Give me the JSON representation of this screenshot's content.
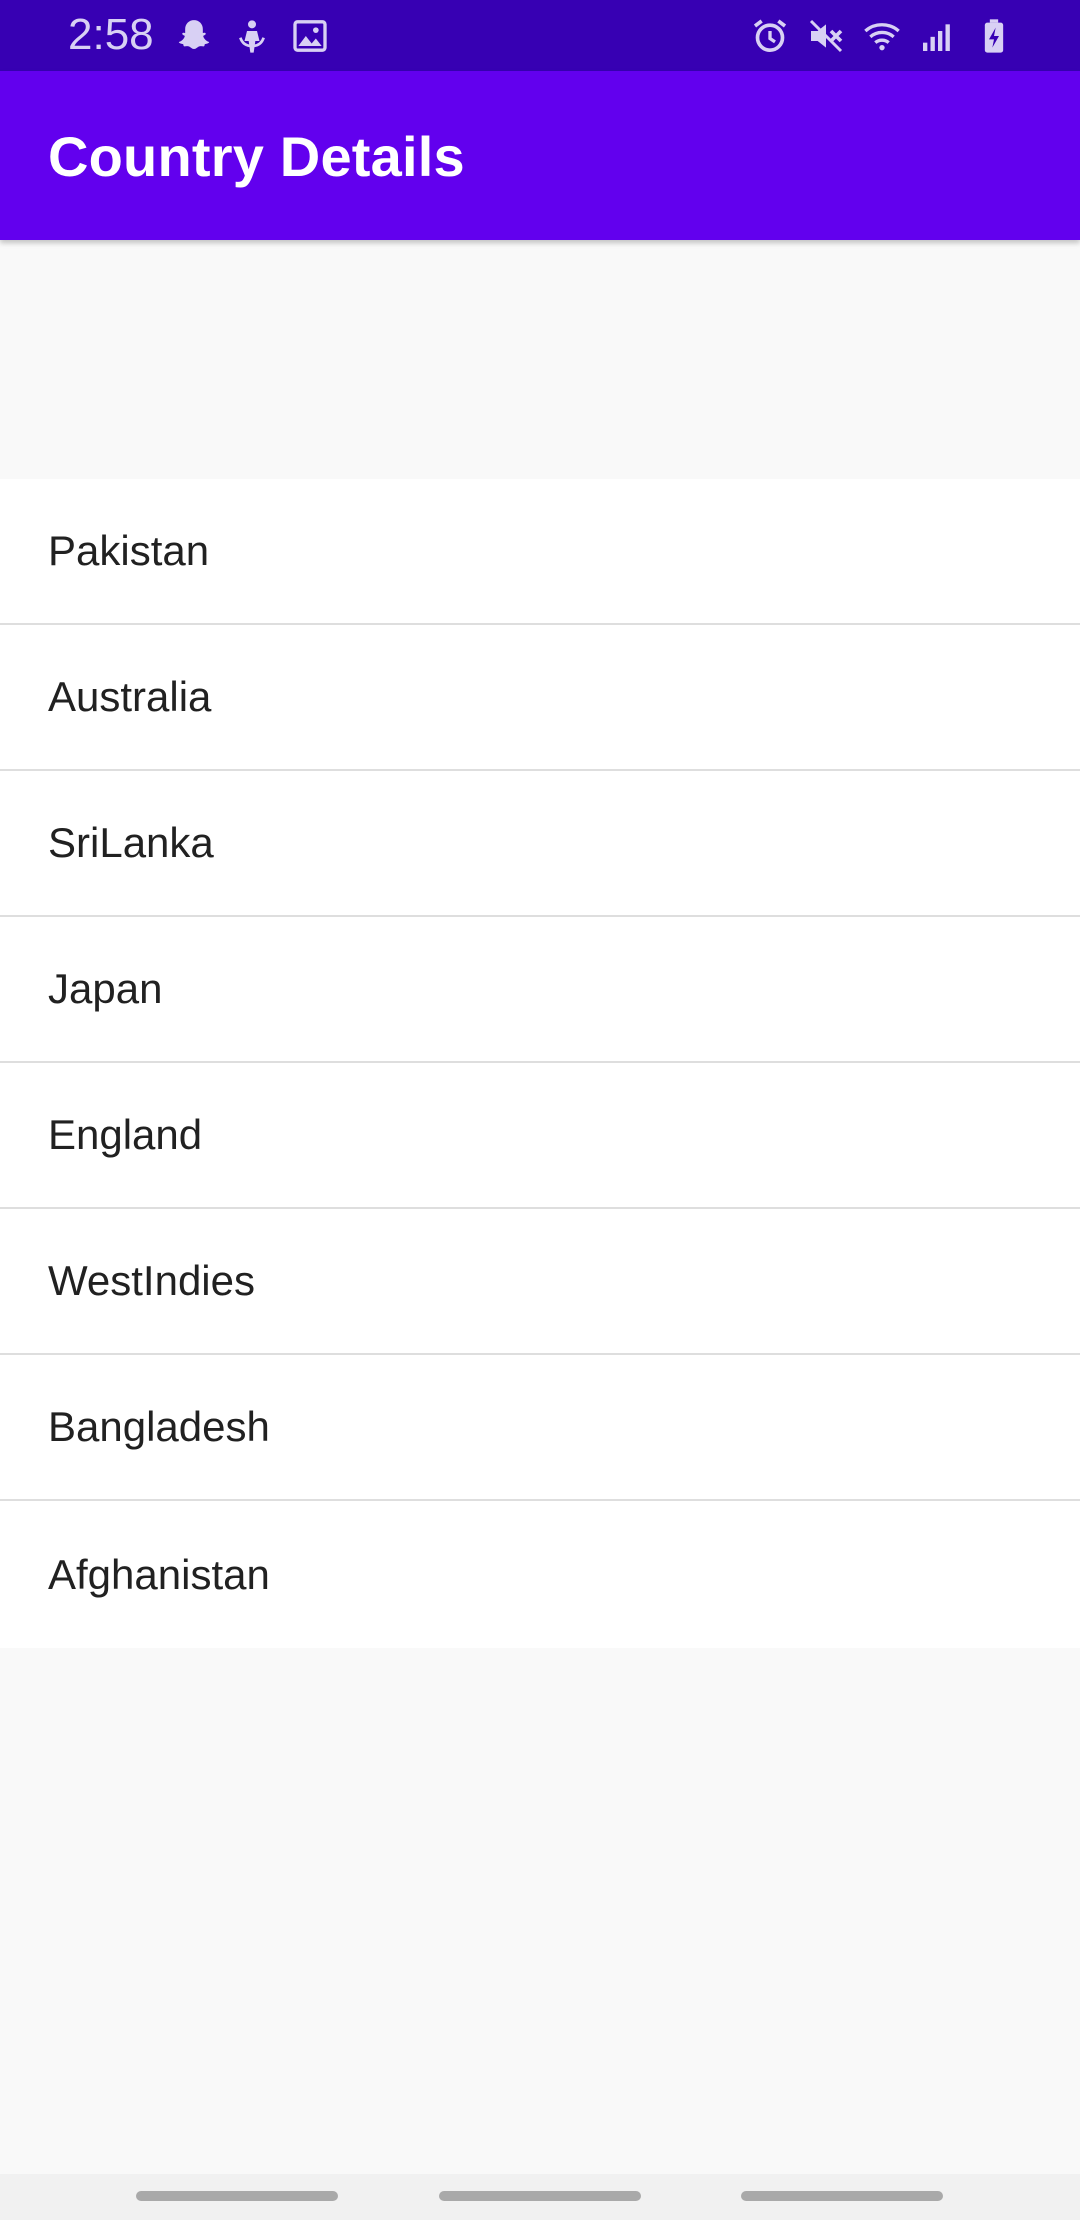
{
  "status_bar": {
    "time": "2:58",
    "left_icons": [
      "snapchat-icon",
      "app-notification-icon",
      "image-icon"
    ],
    "right_icons": [
      "alarm-icon",
      "mute-icon",
      "wifi-icon",
      "signal-icon",
      "battery-charging-icon"
    ],
    "background": "#3700b3"
  },
  "app_bar": {
    "title": "Country Details",
    "background": "#6200ee"
  },
  "countries": [
    "Pakistan",
    "Australia",
    "SriLanka",
    "Japan",
    "England",
    "WestIndies",
    "Bangladesh",
    "Afghanistan"
  ],
  "nav_bar": {
    "buttons": [
      "recent-apps-button",
      "home-button",
      "back-button"
    ]
  }
}
